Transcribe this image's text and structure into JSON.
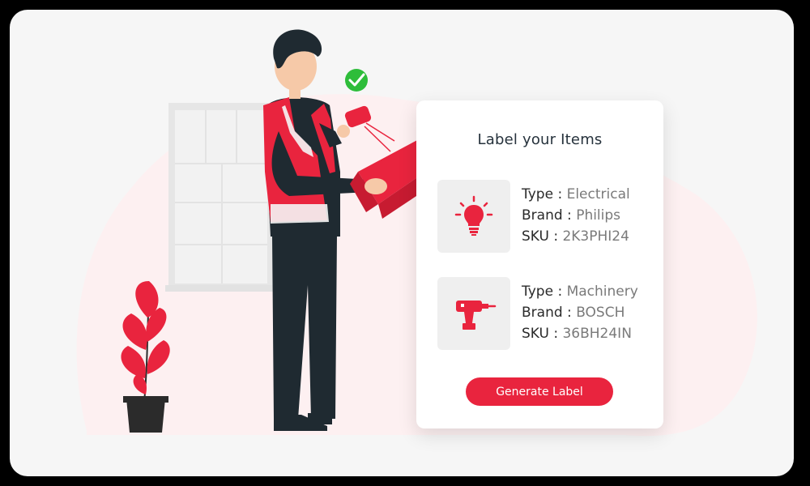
{
  "card": {
    "title": "Label your Items",
    "items": [
      {
        "icon": "lightbulb-icon",
        "type_label": "Type :",
        "type_value": "Electrical",
        "brand_label": "Brand :",
        "brand_value": "Philips",
        "sku_label": "SKU :",
        "sku_value": "2K3PHI24"
      },
      {
        "icon": "power-drill-icon",
        "type_label": "Type :",
        "type_value": "Machinery",
        "brand_label": "Brand :",
        "brand_value": "BOSCH",
        "sku_label": "SKU :",
        "sku_value": "36BH24IN"
      }
    ],
    "button_label": "Generate Label"
  },
  "colors": {
    "accent": "#e9243e",
    "background": "#f6f6f6",
    "card": "#ffffff",
    "icon_box": "#efefef",
    "check": "#2ebd3a"
  }
}
